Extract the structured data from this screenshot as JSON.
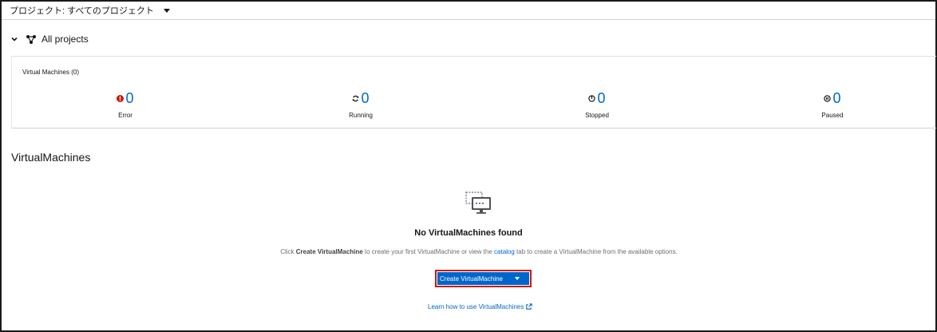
{
  "project_bar": {
    "label": "プロジェクト: すべてのプロジェクト"
  },
  "all_projects": {
    "label": "All projects"
  },
  "vm_summary": {
    "title": "Virtual Machines (0)",
    "statuses": [
      {
        "name": "error",
        "count": "0",
        "label": "Error",
        "icon": "exclamation-circle-icon",
        "color": "#c9190b"
      },
      {
        "name": "running",
        "count": "0",
        "label": "Running",
        "icon": "sync-icon",
        "color": "#151515"
      },
      {
        "name": "stopped",
        "count": "0",
        "label": "Stopped",
        "icon": "power-off-icon",
        "color": "#151515"
      },
      {
        "name": "paused",
        "count": "0",
        "label": "Paused",
        "icon": "pause-circle-icon",
        "color": "#151515"
      }
    ]
  },
  "section": {
    "title": "VirtualMachines"
  },
  "empty_state": {
    "icon": "virtual-machine-icon",
    "title": "No VirtualMachines found",
    "body_prefix": "Click ",
    "body_bold": "Create VirtualMachine",
    "body_middle": " to create your first VirtualMachine or view the ",
    "body_link": "catalog",
    "body_suffix": " tab to create a VirtualMachine from the available options.",
    "create_button": "Create VirtualMachine",
    "learn_link": "Learn how to use VirtualMachines"
  },
  "colors": {
    "link": "#0066cc",
    "button": "#0066cc",
    "highlight": "#c9190b",
    "error": "#c9190b"
  }
}
